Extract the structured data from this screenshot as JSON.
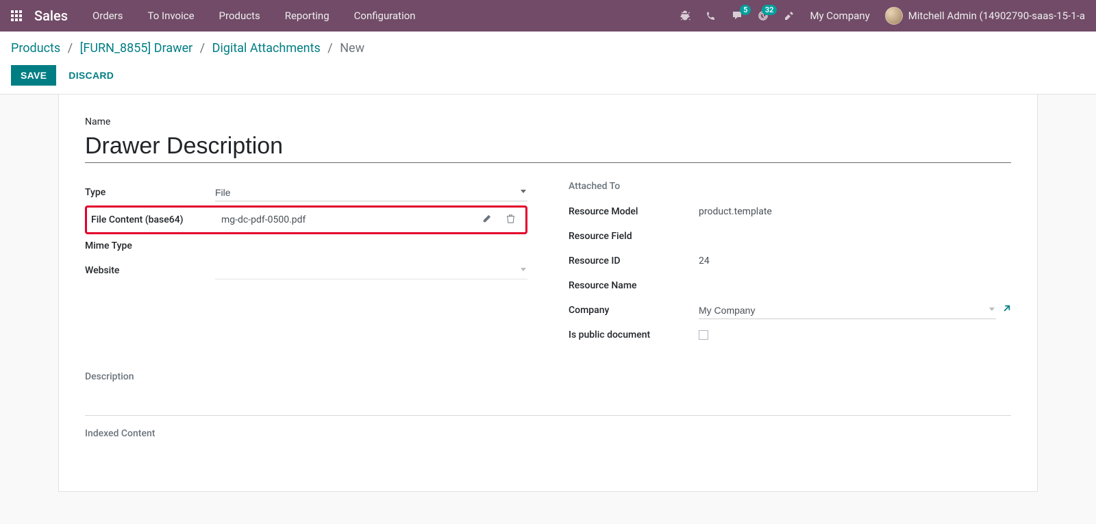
{
  "nav": {
    "brand": "Sales",
    "items": [
      "Orders",
      "To Invoice",
      "Products",
      "Reporting",
      "Configuration"
    ],
    "messages_badge": "5",
    "activities_badge": "32",
    "company": "My Company",
    "user": "Mitchell Admin (14902790-saas-15-1-a"
  },
  "breadcrumb": {
    "p0": "Products",
    "p1": "[FURN_8855] Drawer",
    "p2": "Digital Attachments",
    "current": "New"
  },
  "buttons": {
    "save": "SAVE",
    "discard": "DISCARD"
  },
  "form": {
    "name_label": "Name",
    "name_value": "Drawer Description",
    "left": {
      "type_label": "Type",
      "type_value": "File",
      "file_content_label": "File Content (base64)",
      "file_content_value": "mg-dc-pdf-0500.pdf",
      "mime_label": "Mime Type",
      "website_label": "Website"
    },
    "right": {
      "attached_title": "Attached To",
      "res_model_label": "Resource Model",
      "res_model_value": "product.template",
      "res_field_label": "Resource Field",
      "res_id_label": "Resource ID",
      "res_id_value": "24",
      "res_name_label": "Resource Name",
      "company_label": "Company",
      "company_value": "My Company",
      "public_label": "Is public document"
    },
    "description_title": "Description",
    "indexed_title": "Indexed Content"
  }
}
